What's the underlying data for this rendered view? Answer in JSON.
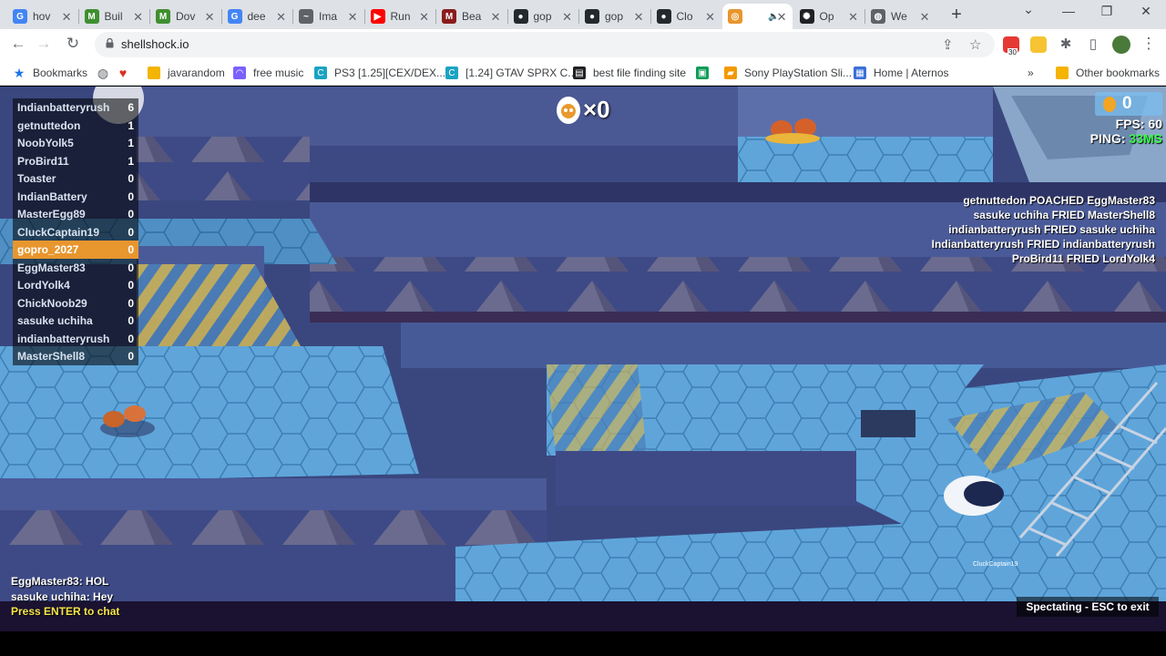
{
  "browser": {
    "tabs": [
      {
        "title": "hov",
        "favicon": "google-icon",
        "color": "#4285f4",
        "glyph": "G"
      },
      {
        "title": "Buil",
        "favicon": "minecraft-icon",
        "color": "#3f8f2f",
        "glyph": "M"
      },
      {
        "title": "Dov",
        "favicon": "minecraft-icon",
        "color": "#3f8f2f",
        "glyph": "M"
      },
      {
        "title": "dee",
        "favicon": "google-icon",
        "color": "#4285f4",
        "glyph": "G"
      },
      {
        "title": "Ima",
        "favicon": "chart-icon",
        "color": "#5f6368",
        "glyph": "~"
      },
      {
        "title": "Run",
        "favicon": "youtube-icon",
        "color": "#ff0000",
        "glyph": "▶"
      },
      {
        "title": "Bea",
        "favicon": "m-logo-icon",
        "color": "#8a1c1c",
        "glyph": "M"
      },
      {
        "title": "gop",
        "favicon": "github-icon",
        "color": "#24292e",
        "glyph": "●"
      },
      {
        "title": "gop",
        "favicon": "github-icon",
        "color": "#24292e",
        "glyph": "●"
      },
      {
        "title": "Clo",
        "favicon": "github-icon",
        "color": "#24292e",
        "glyph": "●"
      },
      {
        "title": "",
        "favicon": "shellshock-icon",
        "color": "#e8962e",
        "glyph": "◎",
        "active": true
      },
      {
        "title": "Op",
        "favicon": "openai-icon",
        "color": "#202124",
        "glyph": "✺"
      },
      {
        "title": "We",
        "favicon": "globe-icon",
        "color": "#5f6368",
        "glyph": "◍"
      }
    ],
    "url": "shellshock.io",
    "bookmarks": [
      {
        "label": "Bookmarks",
        "icon": "star-icon"
      },
      {
        "label": "",
        "icon": "globe-icon"
      },
      {
        "label": "",
        "icon": "heart-icon"
      },
      {
        "label": "javarandom",
        "icon": "folder-icon"
      },
      {
        "label": "free music",
        "icon": "headphones-icon"
      },
      {
        "label": "PS3 [1.25][CEX/DEX...",
        "icon": "c-logo-icon"
      },
      {
        "label": "[1.24] GTAV SPRX C...",
        "icon": "c-logo-icon"
      },
      {
        "label": "best file finding site",
        "icon": "film-icon"
      },
      {
        "label": "",
        "icon": "app-icon"
      },
      {
        "label": "Sony PlayStation Sli...",
        "icon": "bag-icon"
      },
      {
        "label": "Home | Aternos",
        "icon": "aternos-icon"
      },
      {
        "label": "Other bookmarks",
        "icon": "folder-icon"
      }
    ],
    "extension_badge": "30"
  },
  "game": {
    "scoreboard": [
      {
        "name": "Indianbatteryrush",
        "score": "6"
      },
      {
        "name": "getnuttedon",
        "score": "1"
      },
      {
        "name": "NoobYolk5",
        "score": "1"
      },
      {
        "name": "ProBird11",
        "score": "1"
      },
      {
        "name": "Toaster",
        "score": "0"
      },
      {
        "name": "IndianBattery",
        "score": "0"
      },
      {
        "name": "MasterEgg89",
        "score": "0"
      },
      {
        "name": "CluckCaptain19",
        "score": "0"
      },
      {
        "name": "gopro_2027",
        "score": "0",
        "me": true
      },
      {
        "name": "EggMaster83",
        "score": "0"
      },
      {
        "name": "LordYolk4",
        "score": "0"
      },
      {
        "name": "ChickNoob29",
        "score": "0"
      },
      {
        "name": "sasuke uchiha",
        "score": "0"
      },
      {
        "name": "indianbatteryrush",
        "score": "0"
      },
      {
        "name": "MasterShell8",
        "score": "0"
      }
    ],
    "kill_count": "×0",
    "egg_count": "0",
    "fps_label": "FPS:",
    "fps_value": "60",
    "ping_label": "PING:",
    "ping_value": "33MS",
    "killfeed": [
      "getnuttedon POACHED EggMaster83",
      "sasuke uchiha FRIED MasterShell8",
      "indianbatteryrush FRIED sasuke uchiha",
      "Indianbatteryrush FRIED indianbatteryrush",
      "ProBird11 FRIED LordYolk4"
    ],
    "chat": [
      "EggMaster83: HOL",
      "sasuke uchiha: Hey"
    ],
    "chat_prompt": "Press ENTER to chat",
    "spectating": "Spectating - ESC to exit",
    "player_nametag": "CluckCaptain19",
    "colors": {
      "highlight_row": "#e8962e",
      "ping_green": "#39ff4a",
      "floor_blue": "#5a9fd4",
      "wall_purple": "#3b3f6e"
    }
  }
}
